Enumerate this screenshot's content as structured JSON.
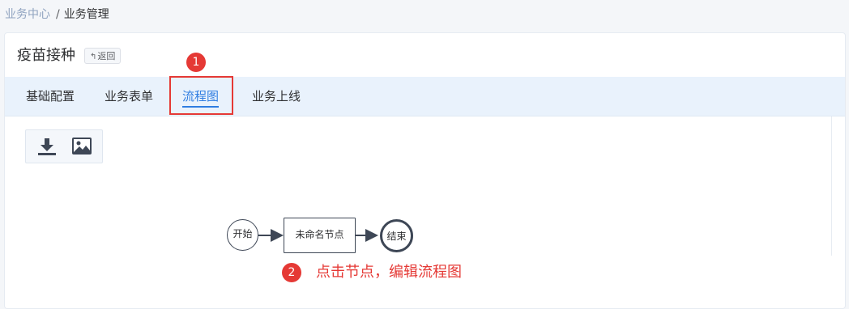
{
  "breadcrumb": {
    "root": "业务中心",
    "separator": "/",
    "current": "业务管理"
  },
  "page": {
    "title": "疫苗接种",
    "back_label": "返回",
    "back_icon": "return-icon"
  },
  "tabs": [
    {
      "label": "基础配置",
      "active": false
    },
    {
      "label": "业务表单",
      "active": false
    },
    {
      "label": "流程图",
      "active": true
    },
    {
      "label": "业务上线",
      "active": false
    }
  ],
  "toolbar": {
    "download_icon": "download-icon",
    "image_icon": "image-icon"
  },
  "flow": {
    "start_label": "开始",
    "task_label": "未命名节点",
    "end_label": "结束"
  },
  "annotations": {
    "step1_number": "1",
    "step2_number": "2",
    "hint_text": "点击节点，编辑流程图",
    "accent_color": "#e53935"
  },
  "colors": {
    "tab_active": "#2f7de1",
    "tab_bar_bg": "#e9f2fc",
    "link": "#8fa3c0"
  }
}
